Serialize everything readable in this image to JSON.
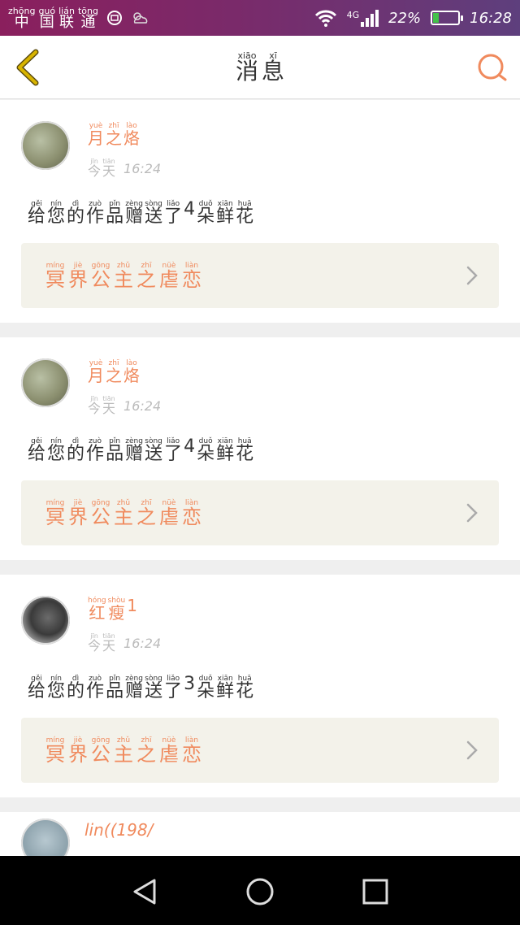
{
  "status_bar": {
    "carrier": [
      {
        "py": "zhōng",
        "hz": "中"
      },
      {
        "py": "guó",
        "hz": "国"
      },
      {
        "py": "lián",
        "hz": "联"
      },
      {
        "py": "tōng",
        "hz": "通"
      }
    ],
    "network": "4G",
    "battery": "22%",
    "battery_level": 0.22,
    "time": "16:28"
  },
  "header": {
    "title": [
      {
        "py": "xiāo",
        "hz": "消"
      },
      {
        "py": "xī",
        "hz": "息"
      }
    ]
  },
  "messages": [
    {
      "username": [
        {
          "py": "yuè",
          "hz": "月"
        },
        {
          "py": "zhī",
          "hz": "之"
        },
        {
          "py": "lào",
          "hz": "烙"
        }
      ],
      "time_label": [
        {
          "py": "jīn",
          "hz": "今"
        },
        {
          "py": "tiān",
          "hz": "天"
        }
      ],
      "time": "16:24",
      "text": [
        {
          "py": "gěi",
          "hz": "给"
        },
        {
          "py": "nín",
          "hz": "您"
        },
        {
          "py": "dì",
          "hz": "的"
        },
        {
          "py": "zuò",
          "hz": "作"
        },
        {
          "py": "pǐn",
          "hz": "品"
        },
        {
          "py": "zèng",
          "hz": "赠"
        },
        {
          "py": "sòng",
          "hz": "送"
        },
        {
          "py": "liǎo",
          "hz": "了"
        },
        {
          "py": "",
          "hz": "4"
        },
        {
          "py": "duǒ",
          "hz": "朵"
        },
        {
          "py": "xiān",
          "hz": "鲜"
        },
        {
          "py": "huā",
          "hz": "花"
        }
      ],
      "work_title": [
        {
          "py": "míng",
          "hz": "冥"
        },
        {
          "py": "jiè",
          "hz": "界"
        },
        {
          "py": "gōng",
          "hz": "公"
        },
        {
          "py": "zhǔ",
          "hz": "主"
        },
        {
          "py": "zhī",
          "hz": "之"
        },
        {
          "py": "nüè",
          "hz": "虐"
        },
        {
          "py": "liàn",
          "hz": "恋"
        }
      ]
    },
    {
      "username": [
        {
          "py": "yuè",
          "hz": "月"
        },
        {
          "py": "zhī",
          "hz": "之"
        },
        {
          "py": "lào",
          "hz": "烙"
        }
      ],
      "time_label": [
        {
          "py": "jīn",
          "hz": "今"
        },
        {
          "py": "tiān",
          "hz": "天"
        }
      ],
      "time": "16:24",
      "text": [
        {
          "py": "gěi",
          "hz": "给"
        },
        {
          "py": "nín",
          "hz": "您"
        },
        {
          "py": "dì",
          "hz": "的"
        },
        {
          "py": "zuò",
          "hz": "作"
        },
        {
          "py": "pǐn",
          "hz": "品"
        },
        {
          "py": "zèng",
          "hz": "赠"
        },
        {
          "py": "sòng",
          "hz": "送"
        },
        {
          "py": "liǎo",
          "hz": "了"
        },
        {
          "py": "",
          "hz": "4"
        },
        {
          "py": "duǒ",
          "hz": "朵"
        },
        {
          "py": "xiān",
          "hz": "鲜"
        },
        {
          "py": "huā",
          "hz": "花"
        }
      ],
      "work_title": [
        {
          "py": "míng",
          "hz": "冥"
        },
        {
          "py": "jiè",
          "hz": "界"
        },
        {
          "py": "gōng",
          "hz": "公"
        },
        {
          "py": "zhǔ",
          "hz": "主"
        },
        {
          "py": "zhī",
          "hz": "之"
        },
        {
          "py": "nüè",
          "hz": "虐"
        },
        {
          "py": "liàn",
          "hz": "恋"
        }
      ]
    },
    {
      "username": [
        {
          "py": "hóng",
          "hz": "红"
        },
        {
          "py": "shòu",
          "hz": "瘦"
        },
        {
          "py": "",
          "hz": "1"
        }
      ],
      "time_label": [
        {
          "py": "jīn",
          "hz": "今"
        },
        {
          "py": "tiān",
          "hz": "天"
        }
      ],
      "time": "16:24",
      "text": [
        {
          "py": "gěi",
          "hz": "给"
        },
        {
          "py": "nín",
          "hz": "您"
        },
        {
          "py": "dì",
          "hz": "的"
        },
        {
          "py": "zuò",
          "hz": "作"
        },
        {
          "py": "pǐn",
          "hz": "品"
        },
        {
          "py": "zèng",
          "hz": "赠"
        },
        {
          "py": "sòng",
          "hz": "送"
        },
        {
          "py": "liǎo",
          "hz": "了"
        },
        {
          "py": "",
          "hz": "3"
        },
        {
          "py": "duǒ",
          "hz": "朵"
        },
        {
          "py": "xiān",
          "hz": "鲜"
        },
        {
          "py": "huā",
          "hz": "花"
        }
      ],
      "work_title": [
        {
          "py": "míng",
          "hz": "冥"
        },
        {
          "py": "jiè",
          "hz": "界"
        },
        {
          "py": "gōng",
          "hz": "公"
        },
        {
          "py": "zhǔ",
          "hz": "主"
        },
        {
          "py": "zhī",
          "hz": "之"
        },
        {
          "py": "nüè",
          "hz": "虐"
        },
        {
          "py": "liàn",
          "hz": "恋"
        }
      ]
    }
  ],
  "partial_item": {
    "username": "lin((198/"
  },
  "icons": {
    "back": "back-chevron-icon",
    "search": "search-icon",
    "wifi": "wifi-icon",
    "signal": "signal-icon",
    "battery": "battery-icon",
    "chevron": "chevron-right-icon",
    "nav_back": "nav-back-icon",
    "nav_home": "nav-home-icon",
    "nav_recents": "nav-recents-icon"
  },
  "colors": {
    "accent": "#f08a5d",
    "back_icon": "#c8a800"
  }
}
